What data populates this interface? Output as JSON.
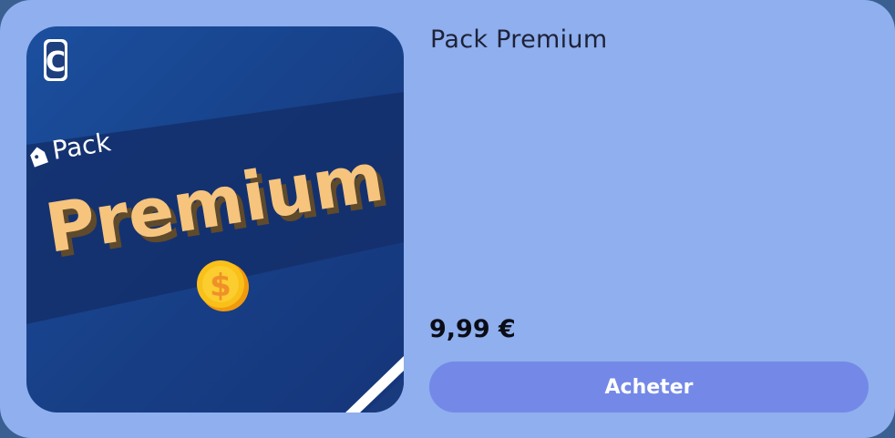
{
  "product": {
    "title": "Pack Premium",
    "price": "9,99 €",
    "buy_label": "Acheter"
  },
  "thumbnail": {
    "logo_letter": "C",
    "pack_word": "Pack",
    "premium_word": "Premium",
    "coin_symbol": "$"
  },
  "colors": {
    "card_bg": "#8fafee",
    "button_bg": "#7489e7",
    "thumb_blue": "#173f86",
    "premium_text": "#f6c47d",
    "coin": "#f7b916"
  }
}
